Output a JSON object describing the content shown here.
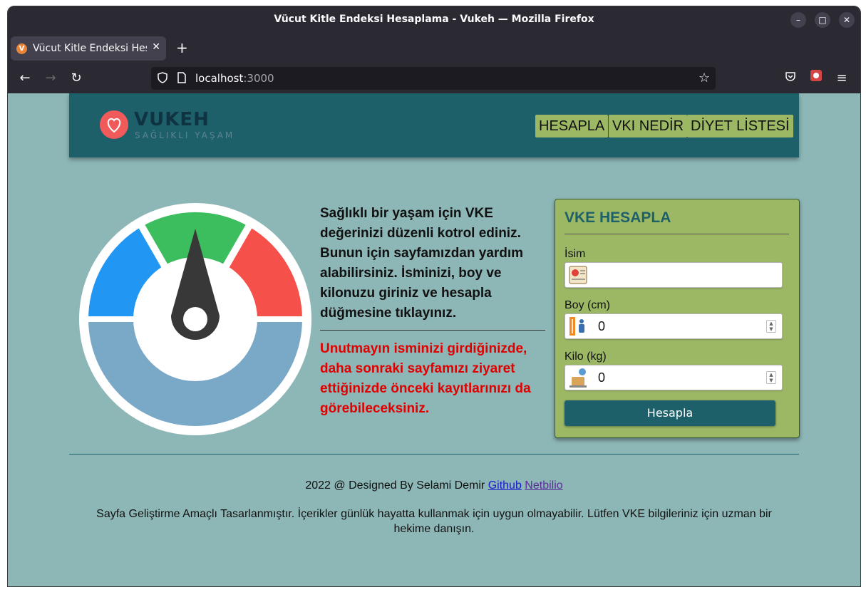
{
  "browser": {
    "window_title": "Vücut Kitle Endeksi Hesaplama - Vukeh — Mozilla Firefox",
    "tab_title": "Vücut Kitle Endeksi Hesaplama - Vukeh",
    "url_host": "localhost",
    "url_port": ":3000"
  },
  "site": {
    "logo_title": "VUKEH",
    "logo_subtitle": "SAĞLIKLI YAŞAM",
    "nav": [
      "HESAPLA",
      "VKI NEDİR",
      "DİYET LİSTESİ"
    ]
  },
  "main": {
    "intro": "Sağlıklı bir yaşam için VKE değerinizi düzenli kotrol ediniz. Bunun için sayfamızdan yardım alabilirsiniz. İsminizi, boy ve kilonuzu giriniz ve hesapla düğmesine tıklayınız.",
    "warning": "Unutmayın isminizi girdiğinizde, daha sonraki sayfamızı ziyaret ettiğinizde önceki kayıtlarınızı da görebileceksiniz."
  },
  "form": {
    "title": "VKE HESAPLA",
    "name_label": "İsim",
    "name_value": "",
    "height_label": "Boy (cm)",
    "height_value": "0",
    "weight_label": "Kilo (kg)",
    "weight_value": "0",
    "submit_label": "Hesapla"
  },
  "footer": {
    "credit": "2022 @ Designed By Selami Demir",
    "github_link": "Github",
    "netbilio_link": "Netbilio",
    "disclaimer": "Sayfa Geliştirme Amaçlı Tasarlanmıştır. İçerikler günlük hayatta kullanmak için uygun olmayabilir. Lütfen VKE bilgileriniz için uzman bir hekime danışın."
  },
  "colors": {
    "header_bg": "#1e606a",
    "page_bg": "#8db7b6",
    "accent_green": "#9cb865",
    "warning_red": "#e00000",
    "gauge_blue": "#2196f3",
    "gauge_green": "#3cbd5e",
    "gauge_red": "#f5504a",
    "gauge_base": "#7aa9c8"
  }
}
